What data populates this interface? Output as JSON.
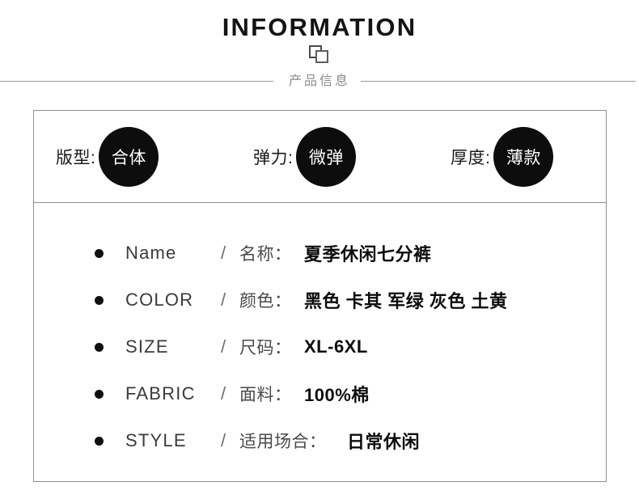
{
  "header": {
    "title": "INFORMATION",
    "ornament_icon": "double-square-icon",
    "subtitle": "产品信息"
  },
  "badges": [
    {
      "label": "版型:",
      "value": "合体",
      "name": "fit"
    },
    {
      "label": "弹力:",
      "value": "微弹",
      "name": "elasticity"
    },
    {
      "label": "厚度:",
      "value": "薄款",
      "name": "thickness"
    }
  ],
  "specs": [
    {
      "en": "Name",
      "slash": "/",
      "cn": "名称：",
      "value": "夏季休闲七分裤"
    },
    {
      "en": "COLOR",
      "slash": "/",
      "cn": "颜色：",
      "value": "黑色 卡其 军绿 灰色 土黄"
    },
    {
      "en": "SIZE",
      "slash": "/",
      "cn": "尺码：",
      "value": "XL-6XL"
    },
    {
      "en": "FABRIC",
      "slash": "/",
      "cn": "面料：",
      "value": "100%棉"
    },
    {
      "en": "STYLE",
      "slash": "/",
      "cn": "适用场合：",
      "value": "日常休闲"
    }
  ],
  "colors": {
    "badge_fill": "#0d0d0d",
    "badge_text": "#ffffff",
    "title_text": "#141414",
    "subtitle_text": "#8c8c8c",
    "rule": "#9a9a9a",
    "panel_border": "#8f8f8f",
    "label_text": "#4a4a4a",
    "value_text": "#0d0d0d",
    "background": "#ffffff"
  }
}
